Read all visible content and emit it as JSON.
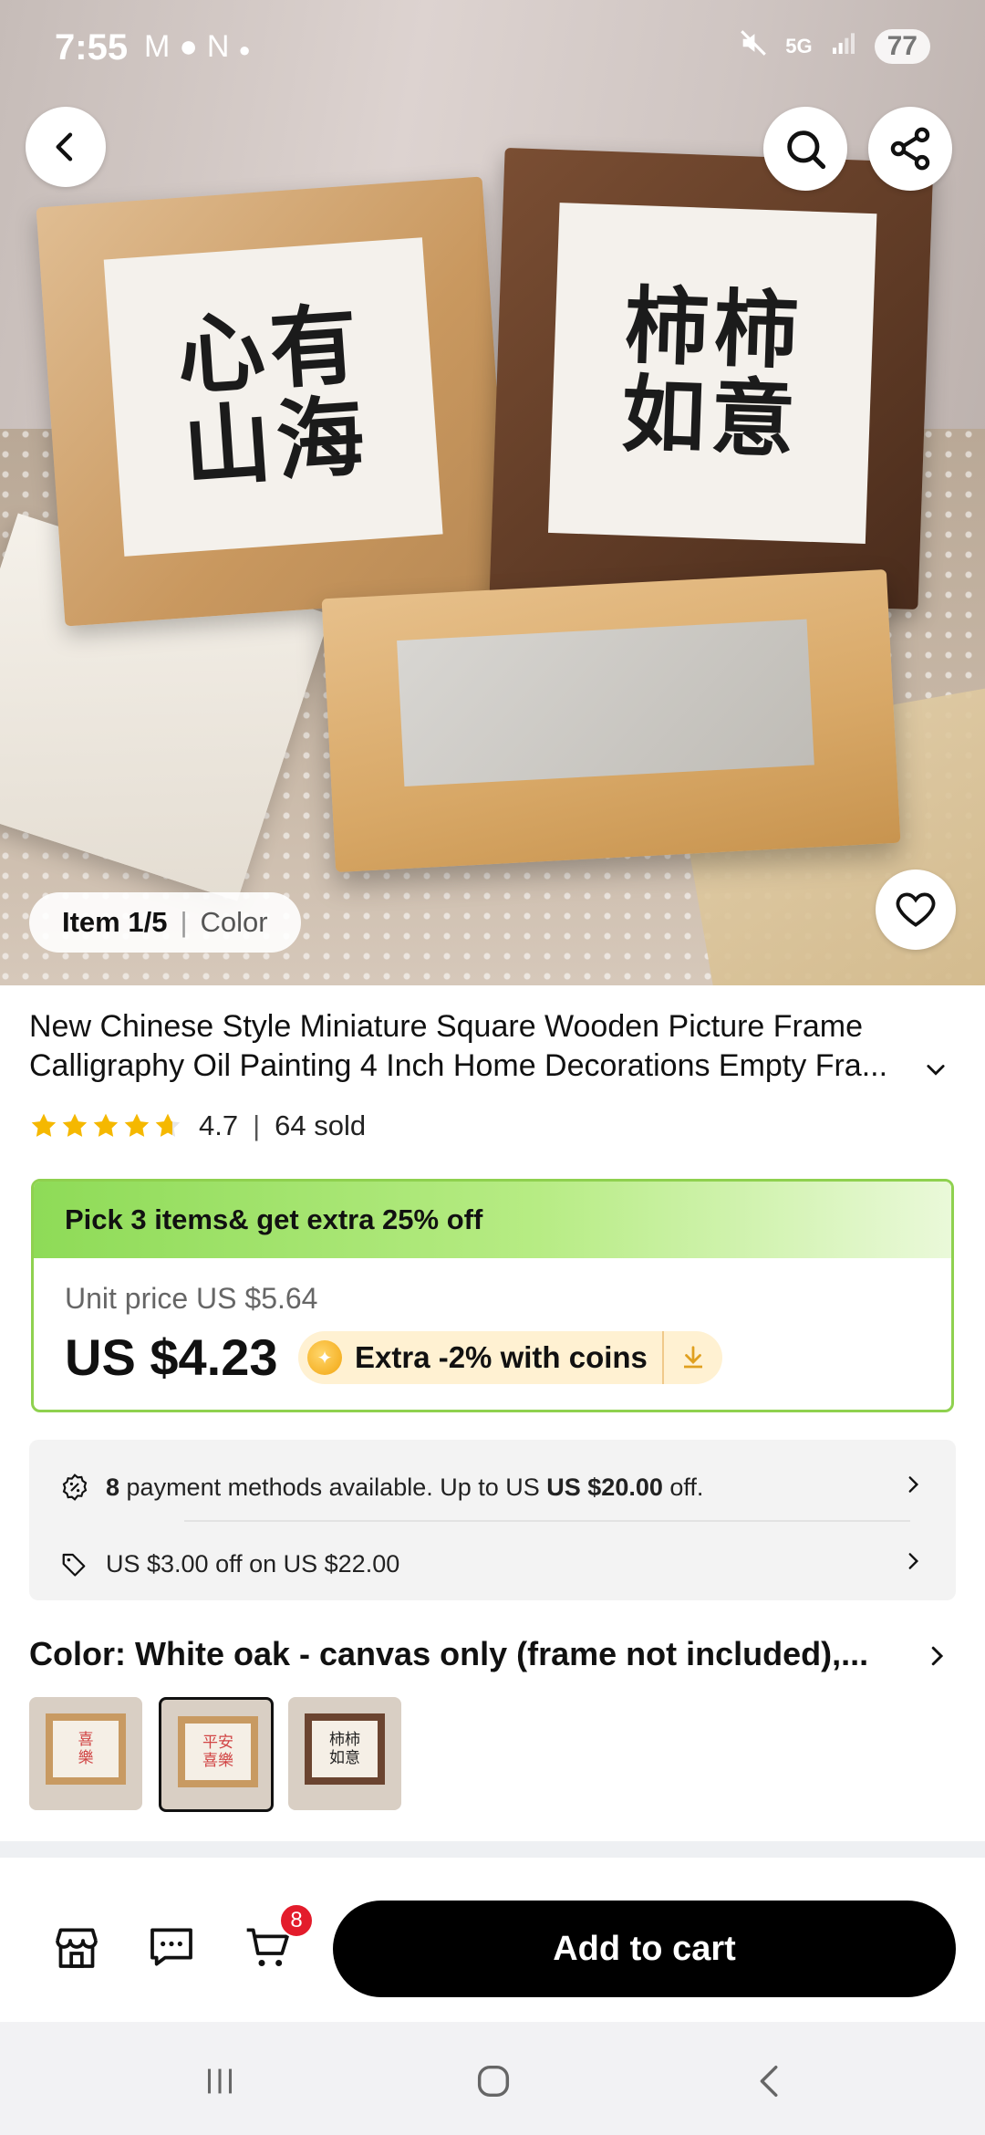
{
  "status_bar": {
    "time": "7:55",
    "notification_icons": [
      "gmail-icon",
      "chat-icon",
      "n-icon",
      "dot-icon"
    ],
    "battery": "77"
  },
  "hero": {
    "frame_left_text": "心有\n山海",
    "frame_right_text": "柿柿\n如意",
    "item_index": "Item 1/5",
    "item_label": "Color"
  },
  "product": {
    "title": "New Chinese Style Miniature Square Wooden Picture Frame Calligraphy Oil Painting 4 Inch Home Decorations Empty Fra...",
    "rating": "4.7",
    "rating_fraction": 0.94,
    "sold": "64 sold"
  },
  "promo": {
    "headline": "Pick 3 items& get extra 25% off",
    "unit_price": "Unit price US $5.64",
    "price": "US $4.23",
    "coins_text": "Extra -2% with coins"
  },
  "payment": {
    "count": "8",
    "methods_text": " payment methods available. Up to US ",
    "amount": "US $20.00",
    "suffix": " off.",
    "coupon_text": "US $3.00 off on US $22.00"
  },
  "color": {
    "label": "Color: White oak - canvas only (frame not included),...",
    "swatches": [
      {
        "text": "喜\n樂"
      },
      {
        "text": "平安\n喜樂"
      },
      {
        "text": "柿柿\n如意"
      }
    ],
    "selected_index": 1
  },
  "actions": {
    "cart_badge": "8",
    "add_to_cart": "Add to cart"
  },
  "colors": {
    "accent_green": "#8fd14f",
    "button_black": "#000000",
    "badge_red": "#e31c2b",
    "star_yellow": "#f5b800"
  }
}
